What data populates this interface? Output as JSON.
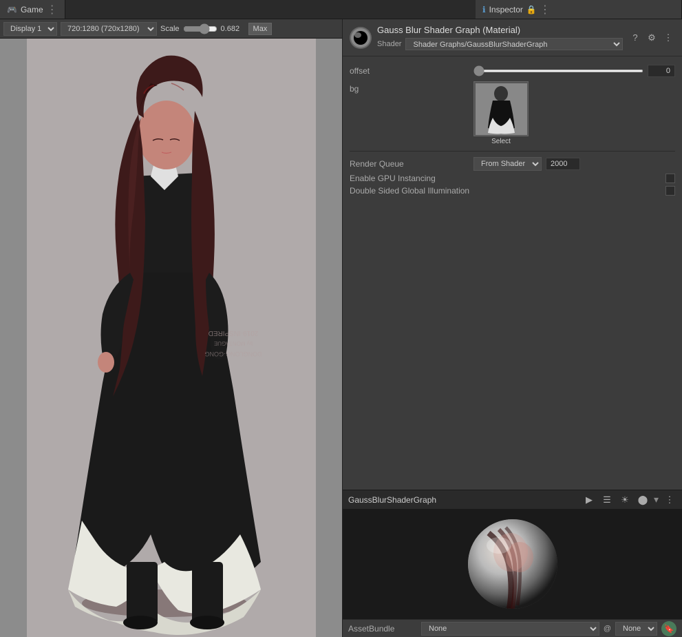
{
  "tabs": {
    "game": {
      "label": "Game",
      "icon": "game-icon"
    },
    "inspector": {
      "label": "Inspector",
      "icon": "info-icon"
    }
  },
  "game_toolbar": {
    "display_label": "Display 1",
    "resolution": "720:1280 (720x1280)",
    "scale_label": "Scale",
    "scale_value": "0.682",
    "max_label": "Max"
  },
  "inspector": {
    "material_name": "Gauss Blur Shader Graph (Material)",
    "shader_label": "Shader",
    "shader_value": "Shader Graphs/GaussBlurShaderGraph",
    "offset_label": "offset",
    "offset_value": "0",
    "bg_label": "bg",
    "select_label": "Select",
    "render_queue_label": "Render Queue",
    "render_queue_value": "From Shader",
    "render_queue_number": "2000",
    "gpu_instancing_label": "Enable GPU Instancing",
    "double_sided_label": "Double Sided Global Illumination"
  },
  "shader_graph": {
    "name": "GaussBlurShaderGraph",
    "play_icon": "▶",
    "menu_icon": "⋮"
  },
  "asset_bundle": {
    "label": "AssetBundle",
    "none_value": "None",
    "at_none": "@None"
  }
}
